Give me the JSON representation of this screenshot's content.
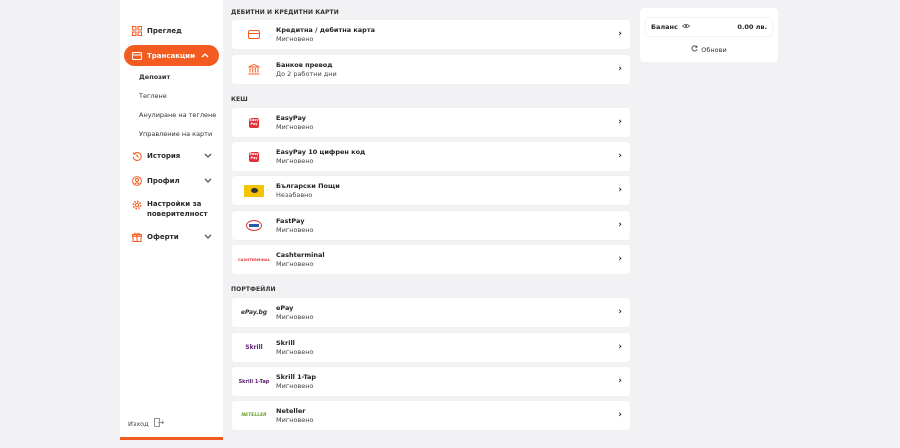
{
  "sidebar": {
    "items": [
      {
        "label": "Преглед",
        "icon": "grid-icon"
      },
      {
        "label": "Трансакции",
        "icon": "credit-card-icon"
      },
      {
        "label": "История",
        "icon": "history-icon"
      },
      {
        "label": "Профил",
        "icon": "user-icon"
      },
      {
        "label": "Настройки за поверителност",
        "icon": "gear-icon"
      },
      {
        "label": "Оферти",
        "icon": "gift-icon"
      }
    ],
    "sub_items": [
      "Депозит",
      "Теглене",
      "Анулиране на теглене",
      "Управление на карти"
    ],
    "logout": "Изход"
  },
  "sections": {
    "cards": "ДЕБИТНИ И КРЕДИТНИ КАРТИ",
    "cash": "КЕШ",
    "wallets": "ПОРТФЕЙЛИ"
  },
  "methods": [
    {
      "name": "Кредитна / дебитна карта",
      "sub": "Мигновено",
      "logo": "card-logo"
    },
    {
      "name": "Банков превод",
      "sub": "До 2 работни дни",
      "logo": "bank-logo"
    },
    {
      "name": "EasyPay",
      "sub": "Мигновено",
      "logo": "easypay-logo"
    },
    {
      "name": "EasyPay 10 цифрен код",
      "sub": "Мигновено",
      "logo": "easypay-logo"
    },
    {
      "name": "Български Пощи",
      "sub": "Незабавно",
      "logo": "bulgarian-posts-logo"
    },
    {
      "name": "FastPay",
      "sub": "Мигновено",
      "logo": "fastpay-logo"
    },
    {
      "name": "Cashterminal",
      "sub": "Мигновено",
      "logo": "cashterminal-logo"
    },
    {
      "name": "ePay",
      "sub": "Мигновено",
      "logo": "epay-logo"
    },
    {
      "name": "Skrill",
      "sub": "Мигновено",
      "logo": "skrill-logo"
    },
    {
      "name": "Skrill 1-Tap",
      "sub": "Мигновено",
      "logo": "skrill-1tap-logo"
    },
    {
      "name": "Neteller",
      "sub": "Мигновено",
      "logo": "neteller-logo"
    }
  ],
  "logo_text": {
    "epay": "ePay.bg",
    "skrill": "Skrill",
    "skrill_1tap": "Skrill 1-Tap",
    "neteller": "NETELLER",
    "cashterminal": "CASHTERMINAL",
    "easypay": "Easy Pay"
  },
  "balance": {
    "label": "Баланс",
    "value": "0.00 лв.",
    "refresh": "Обнови"
  },
  "colors": {
    "accent": "#f35b20"
  }
}
